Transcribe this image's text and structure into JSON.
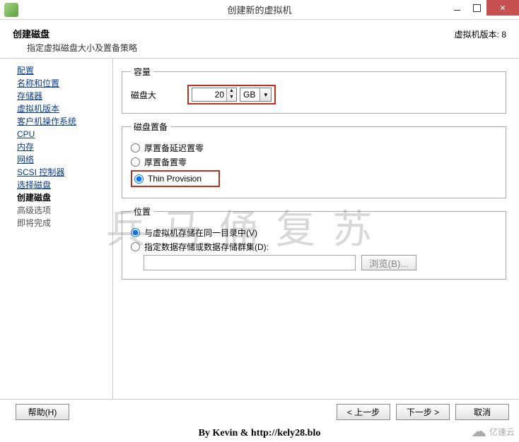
{
  "window": {
    "title": "创建新的虚拟机",
    "version_label": "虚拟机版本: 8"
  },
  "header": {
    "title": "创建磁盘",
    "subtitle": "指定虚拟磁盘大小及置备策略"
  },
  "nav": {
    "items": [
      {
        "label": "配置",
        "state": "link"
      },
      {
        "label": "名称和位置",
        "state": "link"
      },
      {
        "label": "存储器",
        "state": "link"
      },
      {
        "label": "虚拟机版本",
        "state": "link"
      },
      {
        "label": "客户机操作系统",
        "state": "link"
      },
      {
        "label": "CPU",
        "state": "link"
      },
      {
        "label": "内存",
        "state": "link"
      },
      {
        "label": "网络",
        "state": "link"
      },
      {
        "label": "SCSI 控制器",
        "state": "link"
      },
      {
        "label": "选择磁盘",
        "state": "link"
      },
      {
        "label": "创建磁盘",
        "state": "current"
      },
      {
        "label": "高级选项",
        "state": "disabled"
      },
      {
        "label": "即将完成",
        "state": "disabled"
      }
    ]
  },
  "capacity": {
    "legend": "容量",
    "label": "磁盘大",
    "value": "20",
    "unit": "GB"
  },
  "provision": {
    "legend": "磁盘置备",
    "opts": [
      {
        "label": "厚置备延迟置零",
        "checked": false
      },
      {
        "label": "厚置备置零",
        "checked": false
      },
      {
        "label": "Thin Provision",
        "checked": true
      }
    ]
  },
  "location": {
    "legend": "位置",
    "opts": [
      {
        "label": "与虚拟机存储在同一目录中(V)",
        "checked": true
      },
      {
        "label": "指定数据存储或数据存储群集(D):",
        "checked": false
      }
    ],
    "browse": "浏览(B)...",
    "path": ""
  },
  "buttons": {
    "help": "帮助(H)",
    "back": "< 上一步",
    "next": "下一步 >",
    "cancel": "取消"
  },
  "credit": "By Kevin & http://kely28.blo",
  "watermark": "兵马俑复苏",
  "brand": "亿速云"
}
